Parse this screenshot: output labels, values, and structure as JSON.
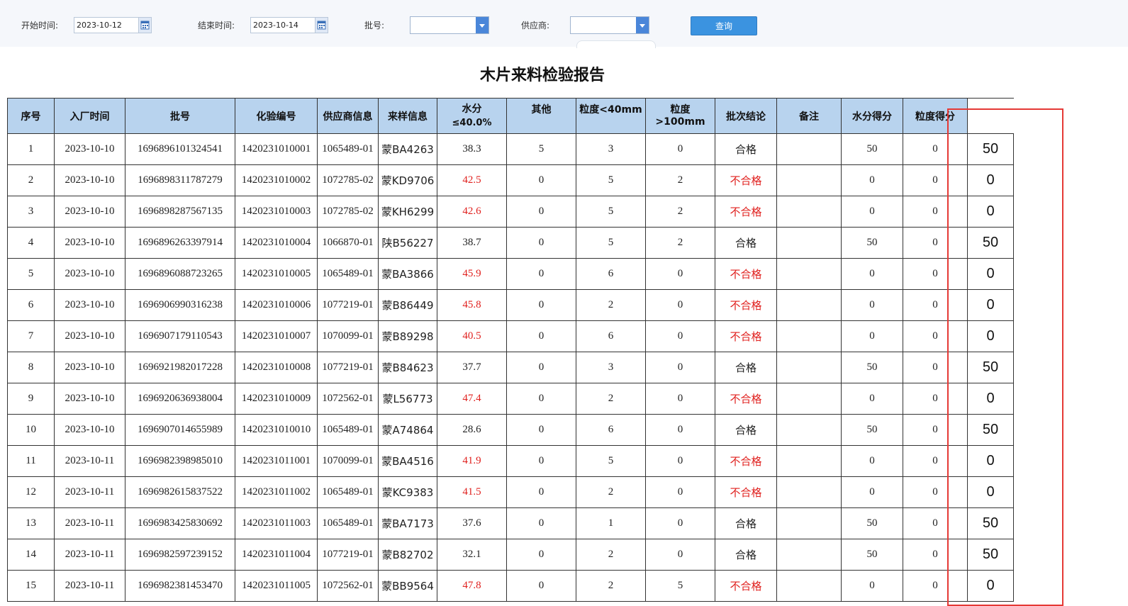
{
  "toolbar": {
    "start_label": "开始时间:",
    "start_value": "2023-10-12",
    "end_label": "结束时间:",
    "end_value": "2023-10-14",
    "batch_label": "批号:",
    "supplier_label": "供应商:",
    "query_label": "查询",
    "calendar_icon": "calendar-icon",
    "dropdown_icon": "chevron-down-icon"
  },
  "report": {
    "title": "木片来料检验报告",
    "headers": {
      "seq": "序号",
      "entry_time": "入厂时间",
      "batch": "批号",
      "test_no": "化验编号",
      "supplier": "供应商信息",
      "sample": "来样信息",
      "moisture_top": "水分",
      "moisture_bottom": "≤40.0%",
      "other": "其他",
      "size_small": "粒度<40mm",
      "size_large": "粒度>100mm",
      "conclusion": "批次结论",
      "remark": "备注",
      "moisture_score": "水分得分",
      "size_score": "粒度得分"
    },
    "colors": {
      "header_bg": "#b8d3ee",
      "fail_text": "#e0201e",
      "highlight_border": "#e53935"
    },
    "rows": [
      {
        "seq": "1",
        "date": "2023-10-10",
        "batch": "1696896101324541",
        "test": "1420231010001",
        "supplier": "1065489-01",
        "sample": "蒙BA4263",
        "moisture": "38.3",
        "moisture_fail": false,
        "other": "5",
        "small": "3",
        "large": "0",
        "result": "合格",
        "result_fail": false,
        "remark": "",
        "mscore": "50",
        "sscore": "0",
        "total": "50"
      },
      {
        "seq": "2",
        "date": "2023-10-10",
        "batch": "1696898311787279",
        "test": "1420231010002",
        "supplier": "1072785-02",
        "sample": "蒙KD9706",
        "moisture": "42.5",
        "moisture_fail": true,
        "other": "0",
        "small": "5",
        "large": "2",
        "result": "不合格",
        "result_fail": true,
        "remark": "",
        "mscore": "0",
        "sscore": "0",
        "total": "0"
      },
      {
        "seq": "3",
        "date": "2023-10-10",
        "batch": "1696898287567135",
        "test": "1420231010003",
        "supplier": "1072785-02",
        "sample": "蒙KH6299",
        "moisture": "42.6",
        "moisture_fail": true,
        "other": "0",
        "small": "5",
        "large": "2",
        "result": "不合格",
        "result_fail": true,
        "remark": "",
        "mscore": "0",
        "sscore": "0",
        "total": "0"
      },
      {
        "seq": "4",
        "date": "2023-10-10",
        "batch": "1696896263397914",
        "test": "1420231010004",
        "supplier": "1066870-01",
        "sample": "陕B56227",
        "moisture": "38.7",
        "moisture_fail": false,
        "other": "0",
        "small": "5",
        "large": "2",
        "result": "合格",
        "result_fail": false,
        "remark": "",
        "mscore": "50",
        "sscore": "0",
        "total": "50"
      },
      {
        "seq": "5",
        "date": "2023-10-10",
        "batch": "1696896088723265",
        "test": "1420231010005",
        "supplier": "1065489-01",
        "sample": "蒙BA3866",
        "moisture": "45.9",
        "moisture_fail": true,
        "other": "0",
        "small": "6",
        "large": "0",
        "result": "不合格",
        "result_fail": true,
        "remark": "",
        "mscore": "0",
        "sscore": "0",
        "total": "0"
      },
      {
        "seq": "6",
        "date": "2023-10-10",
        "batch": "1696906990316238",
        "test": "1420231010006",
        "supplier": "1077219-01",
        "sample": "蒙B86449",
        "moisture": "45.8",
        "moisture_fail": true,
        "other": "0",
        "small": "2",
        "large": "0",
        "result": "不合格",
        "result_fail": true,
        "remark": "",
        "mscore": "0",
        "sscore": "0",
        "total": "0"
      },
      {
        "seq": "7",
        "date": "2023-10-10",
        "batch": "1696907179110543",
        "test": "1420231010007",
        "supplier": "1070099-01",
        "sample": "蒙B89298",
        "moisture": "40.5",
        "moisture_fail": true,
        "other": "0",
        "small": "6",
        "large": "0",
        "result": "不合格",
        "result_fail": true,
        "remark": "",
        "mscore": "0",
        "sscore": "0",
        "total": "0"
      },
      {
        "seq": "8",
        "date": "2023-10-10",
        "batch": "1696921982017228",
        "test": "1420231010008",
        "supplier": "1077219-01",
        "sample": "蒙B84623",
        "moisture": "37.7",
        "moisture_fail": false,
        "other": "0",
        "small": "3",
        "large": "0",
        "result": "合格",
        "result_fail": false,
        "remark": "",
        "mscore": "50",
        "sscore": "0",
        "total": "50"
      },
      {
        "seq": "9",
        "date": "2023-10-10",
        "batch": "1696920636938004",
        "test": "1420231010009",
        "supplier": "1072562-01",
        "sample": "蒙L56773",
        "moisture": "47.4",
        "moisture_fail": true,
        "other": "0",
        "small": "2",
        "large": "0",
        "result": "不合格",
        "result_fail": true,
        "remark": "",
        "mscore": "0",
        "sscore": "0",
        "total": "0"
      },
      {
        "seq": "10",
        "date": "2023-10-10",
        "batch": "1696907014655989",
        "test": "1420231010010",
        "supplier": "1065489-01",
        "sample": "蒙A74864",
        "moisture": "28.6",
        "moisture_fail": false,
        "other": "0",
        "small": "6",
        "large": "0",
        "result": "合格",
        "result_fail": false,
        "remark": "",
        "mscore": "50",
        "sscore": "0",
        "total": "50"
      },
      {
        "seq": "11",
        "date": "2023-10-11",
        "batch": "1696982398985010",
        "test": "1420231011001",
        "supplier": "1070099-01",
        "sample": "蒙BA4516",
        "moisture": "41.9",
        "moisture_fail": true,
        "other": "0",
        "small": "5",
        "large": "0",
        "result": "不合格",
        "result_fail": true,
        "remark": "",
        "mscore": "0",
        "sscore": "0",
        "total": "0"
      },
      {
        "seq": "12",
        "date": "2023-10-11",
        "batch": "1696982615837522",
        "test": "1420231011002",
        "supplier": "1065489-01",
        "sample": "蒙KC9383",
        "moisture": "41.5",
        "moisture_fail": true,
        "other": "0",
        "small": "2",
        "large": "0",
        "result": "不合格",
        "result_fail": true,
        "remark": "",
        "mscore": "0",
        "sscore": "0",
        "total": "0"
      },
      {
        "seq": "13",
        "date": "2023-10-11",
        "batch": "1696983425830692",
        "test": "1420231011003",
        "supplier": "1065489-01",
        "sample": "蒙BA7173",
        "moisture": "37.6",
        "moisture_fail": false,
        "other": "0",
        "small": "1",
        "large": "0",
        "result": "合格",
        "result_fail": false,
        "remark": "",
        "mscore": "50",
        "sscore": "0",
        "total": "50"
      },
      {
        "seq": "14",
        "date": "2023-10-11",
        "batch": "1696982597239152",
        "test": "1420231011004",
        "supplier": "1077219-01",
        "sample": "蒙B82702",
        "moisture": "32.1",
        "moisture_fail": false,
        "other": "0",
        "small": "2",
        "large": "0",
        "result": "合格",
        "result_fail": false,
        "remark": "",
        "mscore": "50",
        "sscore": "0",
        "total": "50"
      },
      {
        "seq": "15",
        "date": "2023-10-11",
        "batch": "1696982381453470",
        "test": "1420231011005",
        "supplier": "1072562-01",
        "sample": "蒙BB9564",
        "moisture": "47.8",
        "moisture_fail": true,
        "other": "0",
        "small": "2",
        "large": "5",
        "result": "不合格",
        "result_fail": true,
        "remark": "",
        "mscore": "0",
        "sscore": "0",
        "total": "0"
      }
    ]
  }
}
